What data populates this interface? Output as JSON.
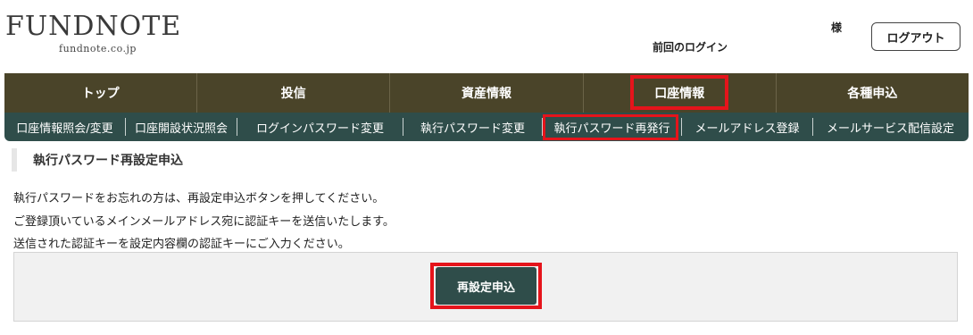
{
  "header": {
    "logo_main": "FUNDNOTE",
    "logo_sub": "fundnote.co.jp",
    "sama": "様",
    "last_login_label": "前回のログイン",
    "logout_label": "ログアウト"
  },
  "main_nav": {
    "items": [
      {
        "label": "トップ"
      },
      {
        "label": "投信"
      },
      {
        "label": "資産情報"
      },
      {
        "label": "口座情報"
      },
      {
        "label": "各種申込"
      }
    ],
    "highlighted_index": 3
  },
  "sub_nav": {
    "items": [
      {
        "label": "口座情報照会/変更"
      },
      {
        "label": "口座開設状況照会"
      },
      {
        "label": "ログインパスワード変更"
      },
      {
        "label": "執行パスワード変更"
      },
      {
        "label": "執行パスワード再発行"
      },
      {
        "label": "メールアドレス登録"
      },
      {
        "label": "メールサービス配信設定"
      }
    ],
    "highlighted_index": 4
  },
  "page": {
    "title": "執行パスワード再設定申込",
    "line1": "執行パスワードをお忘れの方は、再設定申込ボタンを押してください。",
    "line2": "ご登録頂いているメインメールアドレス宛に認証キーを送信いたします。",
    "line3": "送信された認証キーを設定内容欄の認証キーにご入力ください。",
    "button_label": "再設定申込"
  },
  "colors": {
    "main_nav_bg": "#4a4429",
    "sub_nav_bg": "#2f4d4a",
    "highlight": "#e5141b",
    "button_bg": "#2f4d4a"
  }
}
